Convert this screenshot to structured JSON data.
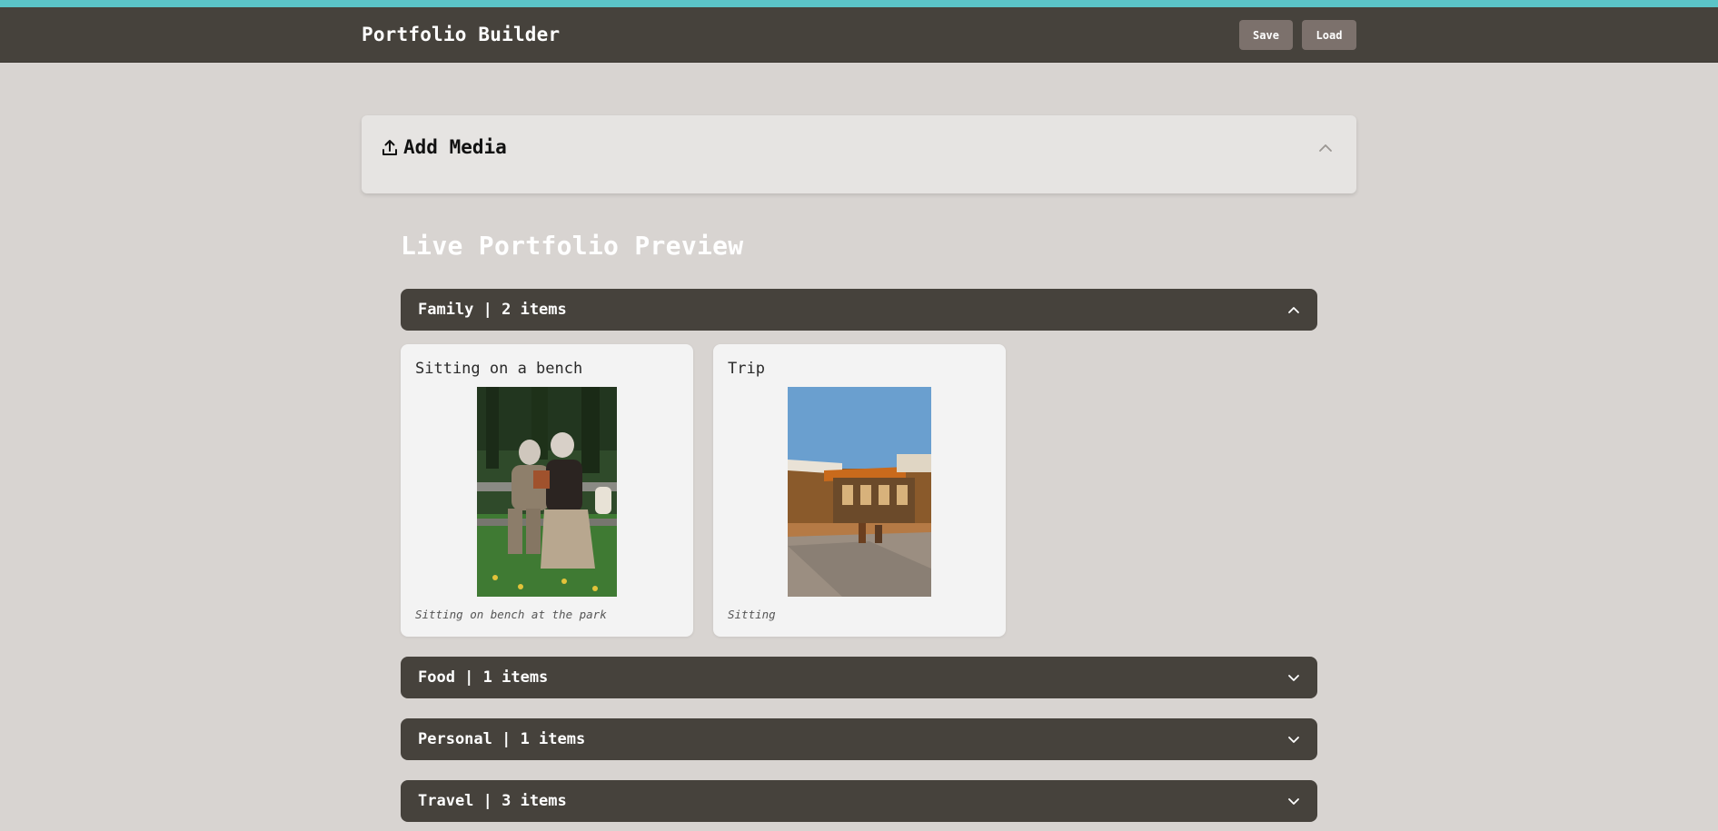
{
  "header": {
    "title": "Portfolio Builder",
    "save_label": "Save",
    "load_label": "Load"
  },
  "add_media": {
    "title": "Add Media",
    "icon": "upload-icon",
    "toggle_icon": "chevron-up-icon"
  },
  "preview": {
    "title": "Live Portfolio Preview"
  },
  "categories": [
    {
      "label": "Family | 2 items",
      "expanded": true
    },
    {
      "label": "Food | 1 items",
      "expanded": false
    },
    {
      "label": "Personal | 1 items",
      "expanded": false
    },
    {
      "label": "Travel | 3 items",
      "expanded": false
    }
  ],
  "family_items": [
    {
      "title": "Sitting on a bench",
      "caption": "Sitting on bench at the park"
    },
    {
      "title": "Trip",
      "caption": "Sitting"
    }
  ],
  "colors": {
    "accent": "#5bc4c8",
    "header_bg": "#46423c",
    "page_bg": "#d8d4d1",
    "button_bg": "#7c716c"
  }
}
